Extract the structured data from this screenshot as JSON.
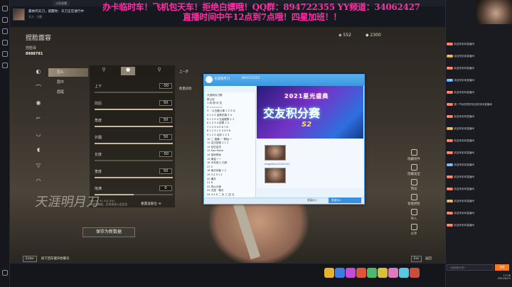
{
  "window": {
    "tab_label": "斗鱼直播",
    "stream_title": "最帅的天刀，提醒你：天刀正在进行中",
    "stream_sub": "天刀 · 主播"
  },
  "banner": {
    "line1": "办卡临时车！飞机包天车！拒绝白嫖哦！QQ群：894722355 YY频道：34062427",
    "line2": "直播时间中午12点到7点哦！四星加班！！",
    "color": "#ff2ea6"
  },
  "game": {
    "title": "捏脸面容",
    "username": "捏脸哥",
    "user_id": "8988781",
    "currency1": "552",
    "currency2": "2300",
    "calligraphy": "天涯明月刀",
    "panel_tabs": [
      "眉头",
      "眉中",
      "眉尾"
    ],
    "sub_items": [
      "眉头",
      "眉中",
      "眉尾"
    ],
    "sliders": [
      {
        "label": "上下",
        "value": "-50",
        "level": 0.0
      },
      {
        "label": "前后",
        "value": "50",
        "level": 1.0
      },
      {
        "label": "角度",
        "value": "50",
        "level": 1.0
      },
      {
        "label": "外翻",
        "value": "50",
        "level": 1.0
      },
      {
        "label": "长度",
        "value": "-50",
        "level": 0.0
      },
      {
        "label": "宽度",
        "value": "50",
        "level": 1.0
      },
      {
        "label": "饱满",
        "value": "0",
        "level": 0.5
      }
    ],
    "reset_hint": "Name: 91.331.891\n请保存数据，否则再进入会丢失",
    "reset_label": "重置该部位",
    "undo": "上一步",
    "compare": "衡量初始",
    "save": "保存为新数据",
    "menu": [
      "隐藏组件",
      "隐藏发型",
      "预设",
      "智能捏脸",
      "导入",
      "分享"
    ],
    "enter_key": "Enter",
    "enter_hint": "按下回车键开始聊天",
    "esc_key": "Esc",
    "esc_hint": "返回"
  },
  "qq": {
    "title": "天涯明月刀",
    "group_id": "894722355",
    "members": [
      "天涯明月刀群",
      "群公告",
      "1 风 明 月 花",
      "2 ======",
      "3 ···1(白鹿公事 1 2 3 4)",
      "4 1 2 3 金葵花旗 3 4",
      "5 1 2 3 4 无量散群 1 2",
      "6 1 2 3 4 鼠群 1 2",
      "7 1 2 3 4 5 6 7 8",
      "8 1 2 3 1 2 3 4 5 6",
      "9 1 2 3 北风 1 2 3",
      "10 二 直播 一 群组 一",
      "11 百日回首 2 1 2",
      "12 钻石会员",
      "13 Sea Monk",
      "14 独剑修仙",
      "15 黄金一一",
      "16 冷月孤人 白夜",
      "17 2",
      "18 每日剑客 1 2",
      "19 3 4 9 1 2",
      "20 雷天",
      "21 6",
      "22 烈火分部",
      "23 天涯 · 聊天",
      "24 4 5 6 二 天 三 四 五"
    ],
    "ad_top": "2021星光盛典",
    "ad_main": "交友积分赛",
    "ad_num": "S2",
    "sender": "Angelabc(2243141)",
    "close": "关闭(C)",
    "send": "发送(S)"
  },
  "chat": {
    "input_placeholder": "一起来聊天吧~",
    "send": "发送",
    "messages": [
      {
        "badge": "粉丝",
        "color": "#e8542f",
        "text": "欢迎来到本直播间"
      },
      {
        "badge": "贵族",
        "color": "#c9951c",
        "text": "欢迎来到本直播间"
      },
      {
        "badge": "粉丝",
        "color": "#e8542f",
        "text": "欢迎来到本直播间"
      },
      {
        "badge": "钻粉",
        "color": "#4f8fe8",
        "text": "欢迎来到本直播间"
      },
      {
        "badge": "粉丝",
        "color": "#e8542f",
        "text": "欢迎来到本直播间"
      },
      {
        "badge": "粉丝",
        "color": "#e8542f",
        "text": "第一节玩的很好欢迎来到本直播间"
      },
      {
        "badge": "粉丝",
        "color": "#e8542f",
        "text": "欢迎来到本直播间"
      },
      {
        "badge": "贵族",
        "color": "#c9951c",
        "text": "欢迎来到本直播间"
      },
      {
        "badge": "粉丝",
        "color": "#e8542f",
        "text": "欢迎来到本直播间"
      },
      {
        "badge": "粉丝",
        "color": "#e8542f",
        "text": "欢迎来到本直播间"
      },
      {
        "badge": "钻粉",
        "color": "#4f8fe8",
        "text": "欢迎来到本直播间"
      },
      {
        "badge": "粉丝",
        "color": "#e8542f",
        "text": "欢迎来到本直播间"
      },
      {
        "badge": "粉丝",
        "color": "#e8542f",
        "text": "欢迎来到本直播间"
      },
      {
        "badge": "贵族",
        "color": "#c9951c",
        "text": "欢迎来到本直播间"
      },
      {
        "badge": "粉丝",
        "color": "#e8542f",
        "text": "欢迎来到本直播间"
      },
      {
        "badge": "粉丝",
        "color": "#e8542f",
        "text": "欢迎来到本直播间"
      }
    ],
    "clock": "17:08\n2021/6/13"
  },
  "gifts": [
    "#e8b22c",
    "#3b7de0",
    "#c54bd8",
    "#e0553a",
    "#4fb86a",
    "#d6c13a",
    "#e07ac0",
    "#5ac8e0",
    "#c8503a"
  ]
}
